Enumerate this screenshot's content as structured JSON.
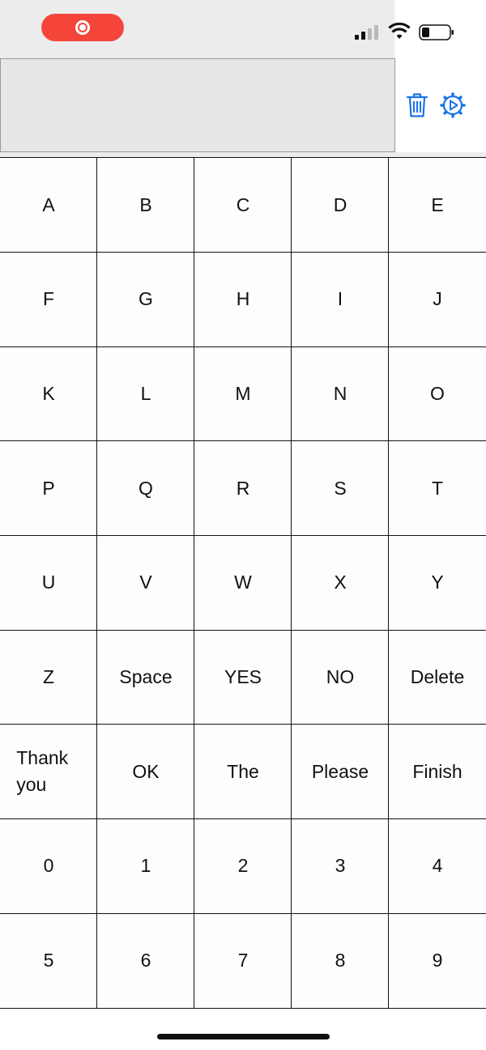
{
  "status_bar": {
    "recording_indicator": "screen-recording-icon",
    "signal_icon": "cellular-signal-icon",
    "wifi_icon": "wifi-icon",
    "battery_icon": "battery-icon"
  },
  "toolbar": {
    "text_display_value": "",
    "delete_icon": "trash-icon",
    "settings_icon": "gear-play-icon"
  },
  "colors": {
    "accent": "#1a73e8",
    "record": "#f5453b",
    "key_border": "#111111"
  },
  "keys": [
    [
      "A",
      "B",
      "C",
      "D",
      "E"
    ],
    [
      "F",
      "G",
      "H",
      "I",
      "J"
    ],
    [
      "K",
      "L",
      "M",
      "N",
      "O"
    ],
    [
      "P",
      "Q",
      "R",
      "S",
      "T"
    ],
    [
      "U",
      "V",
      "W",
      "X",
      "Y"
    ],
    [
      "Z",
      "Space",
      "YES",
      "NO",
      "Delete"
    ],
    [
      "Thank you",
      "OK",
      "The",
      "Please",
      "Finish"
    ],
    [
      "0",
      "1",
      "2",
      "3",
      "4"
    ],
    [
      "5",
      "6",
      "7",
      "8",
      "9"
    ]
  ]
}
